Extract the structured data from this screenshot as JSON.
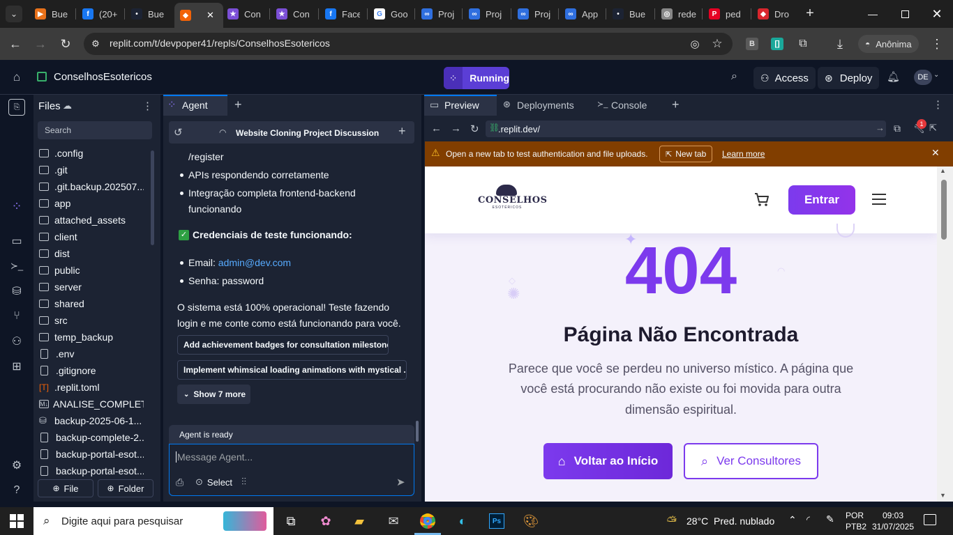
{
  "browser": {
    "tabs": [
      {
        "label": "Bue",
        "color": "#e8711a",
        "glyph": "▶"
      },
      {
        "label": "(20+",
        "color": "#1877f2",
        "glyph": "f"
      },
      {
        "label": "Bue",
        "color": "#1c2333",
        "glyph": "•"
      },
      {
        "label": "",
        "color": "#f26207",
        "glyph": "◆",
        "active": true
      },
      {
        "label": "Con",
        "color": "#7b4fd6",
        "glyph": "★"
      },
      {
        "label": "Con",
        "color": "#7b4fd6",
        "glyph": "★"
      },
      {
        "label": "Face",
        "color": "#1877f2",
        "glyph": "f"
      },
      {
        "label": "Goo",
        "color": "#ffffff",
        "glyph": "G"
      },
      {
        "label": "Proj",
        "color": "#2f6fdf",
        "glyph": "∞"
      },
      {
        "label": "Proj",
        "color": "#2f6fdf",
        "glyph": "∞"
      },
      {
        "label": "Proj",
        "color": "#2f6fdf",
        "glyph": "∞"
      },
      {
        "label": "App",
        "color": "#2f6fdf",
        "glyph": "∞"
      },
      {
        "label": "Bue",
        "color": "#1c2333",
        "glyph": "•"
      },
      {
        "label": "rede",
        "color": "#888888",
        "glyph": "◎"
      },
      {
        "label": "ped",
        "color": "#e60023",
        "glyph": "P"
      },
      {
        "label": "Dro",
        "color": "#d9262d",
        "glyph": "◆"
      }
    ],
    "url": "replit.com/t/devpoper41/repls/ConselhosEsotericos",
    "profile": "Anônima"
  },
  "replit": {
    "project_name": "ConselhosEsotericos",
    "run_status": "Running",
    "access_label": "Access",
    "deploy_label": "Deploy",
    "avatar": "DE"
  },
  "files": {
    "title": "Files",
    "search_placeholder": "Search",
    "items": [
      {
        "name": ".config",
        "kind": "folder"
      },
      {
        "name": ".git",
        "kind": "folder"
      },
      {
        "name": ".git.backup.202507...",
        "kind": "folder"
      },
      {
        "name": "app",
        "kind": "folder"
      },
      {
        "name": "attached_assets",
        "kind": "folder"
      },
      {
        "name": "client",
        "kind": "folder"
      },
      {
        "name": "dist",
        "kind": "folder"
      },
      {
        "name": "public",
        "kind": "folder"
      },
      {
        "name": "server",
        "kind": "folder"
      },
      {
        "name": "shared",
        "kind": "folder"
      },
      {
        "name": "src",
        "kind": "folder"
      },
      {
        "name": "temp_backup",
        "kind": "folder"
      },
      {
        "name": ".env",
        "kind": "file"
      },
      {
        "name": ".gitignore",
        "kind": "file"
      },
      {
        "name": ".replit.toml",
        "kind": "toml"
      },
      {
        "name": "ANALISE_COMPLET...",
        "kind": "md"
      },
      {
        "name": "backup-2025-06-1...",
        "kind": "db"
      },
      {
        "name": "backup-complete-2...",
        "kind": "file"
      },
      {
        "name": "backup-portal-esot...",
        "kind": "file"
      },
      {
        "name": "backup-portal-esot...",
        "kind": "file"
      }
    ],
    "file_button": "File",
    "folder_button": "Folder"
  },
  "agent": {
    "tab_label": "Agent",
    "thread_title": "Website Cloning Project Discussion",
    "register_line": "/register",
    "bullets1": [
      "APIs respondendo corretamente",
      "Integração completa frontend-backend",
      "funcionando"
    ],
    "credentials_heading": "Credenciais de teste funcionando:",
    "email_label": "Email: ",
    "email_value": "admin@dev.com",
    "password_line": "Senha: password",
    "closing_line1": "O sistema está 100% operacional! Teste fazendo",
    "closing_line2": "login e me conte como está funcionando para você.",
    "suggestions": [
      "Add achievement badges for consultation milestones",
      "Implement whimsical loading animations with mystical ..."
    ],
    "show_more": "Show 7 more",
    "status": "Agent is ready",
    "input_placeholder": "Message Agent...",
    "select_label": "Select"
  },
  "preview": {
    "tabs": [
      "Preview",
      "Deployments",
      "Console"
    ],
    "address": ".replit.dev/",
    "notification_count": "1",
    "banner_text": "Open a new tab to test authentication and file uploads.",
    "banner_button": "New tab",
    "banner_link": "Learn more"
  },
  "site": {
    "logo_main": "CONSELHOS",
    "logo_sub": "ESOTÉRICOS",
    "login_button": "Entrar",
    "error_code": "404",
    "error_title": "Página Não Encontrada",
    "error_line1": "Parece que você se perdeu no universo místico. A página que",
    "error_line2": "você está procurando não existe ou foi movida para outra",
    "error_line3": "dimensão espiritual.",
    "home_button": "Voltar ao Início",
    "consultants_button": "Ver Consultores",
    "accent": "#7c3aed"
  },
  "taskbar": {
    "search_placeholder": "Digite aqui para pesquisar",
    "weather": "28°C  Pred. nublado",
    "lang": "POR",
    "layout": "PTB2",
    "time": "09:03",
    "date": "31/07/2025"
  }
}
